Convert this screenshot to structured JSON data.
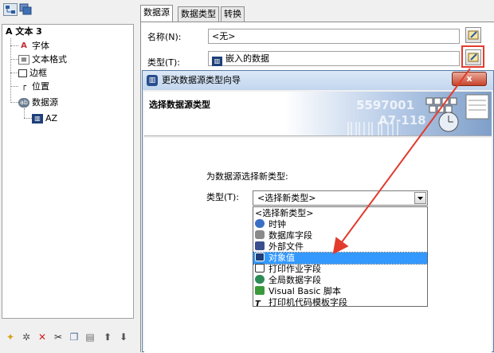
{
  "left_toolbar": {
    "icons": [
      "tree-view-icon",
      "stack-view-icon"
    ]
  },
  "tree": {
    "root": "A  文本 3",
    "items": [
      {
        "label": "字体",
        "icon": "font-icon"
      },
      {
        "label": "文本格式",
        "icon": "text-format-icon"
      },
      {
        "label": "边框",
        "icon": "border-icon"
      },
      {
        "label": "位置",
        "icon": "position-icon"
      },
      {
        "label": "数据源",
        "icon": "data-source-icon"
      }
    ],
    "sub_item": "AZ"
  },
  "bottom_toolbar": {
    "icons": [
      "new-icon",
      "magic-wand-icon",
      "delete-icon",
      "cut-icon",
      "copy-icon",
      "paste-icon",
      "move-up-icon",
      "move-down-icon"
    ]
  },
  "tabs": [
    "数据源",
    "数据类型",
    "转换"
  ],
  "fields": {
    "name_label": "名称(N):",
    "name_value": "<无>",
    "type_label": "类型(T):",
    "type_value": "嵌入的数据"
  },
  "wizard": {
    "title": "更改数据源类型向导",
    "close": "x",
    "header_title": "选择数据源类型",
    "header_image_text": [
      "5597001",
      "A7-118"
    ],
    "prompt": "为数据源选择新类型:",
    "type_label": "类型(T):",
    "select_value": "<选择新类型>",
    "options": [
      {
        "label": "<选择新类型>",
        "icon": ""
      },
      {
        "label": "时钟",
        "icon": "clock-icon"
      },
      {
        "label": "数据库字段",
        "icon": "database-icon"
      },
      {
        "label": "外部文件",
        "icon": "external-file-icon"
      },
      {
        "label": "对象值",
        "icon": "object-value-icon"
      },
      {
        "label": "打印作业字段",
        "icon": "print-job-icon"
      },
      {
        "label": "全局数据字段",
        "icon": "globe-icon"
      },
      {
        "label": "Visual Basic 脚本",
        "icon": "vbscript-icon"
      },
      {
        "label": "打印机代码模板字段",
        "icon": "printer-code-icon"
      }
    ],
    "selected_index": 4
  },
  "colors": {
    "selection": "#3399ff",
    "annotation": "#e23b2e",
    "title_bar": "#c9dcf1"
  }
}
